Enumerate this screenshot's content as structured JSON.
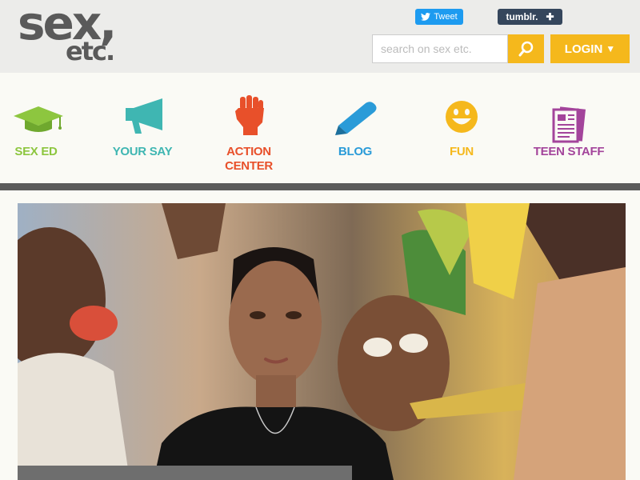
{
  "logo": {
    "line1": "sex,",
    "line2": "etc."
  },
  "social": {
    "tweet_label": "Tweet",
    "tumblr_label": "tumblr.",
    "tumblr_plus": "✚"
  },
  "search": {
    "placeholder": "search on sex etc.",
    "value": ""
  },
  "login": {
    "label": "LOGIN",
    "caret": "▼"
  },
  "nav": {
    "items": [
      {
        "label": "SEX ED",
        "color": "#8dc63f",
        "icon": "graduation-cap-icon"
      },
      {
        "label": "YOUR SAY",
        "color": "#3fb6b2",
        "icon": "megaphone-icon"
      },
      {
        "label": "ACTION\nCENTER",
        "color": "#e8502a",
        "icon": "raised-fist-icon"
      },
      {
        "label": "BLOG",
        "color": "#2a9bd8",
        "icon": "pencil-icon"
      },
      {
        "label": "FUN",
        "color": "#f5b81c",
        "icon": "smiley-face-icon"
      },
      {
        "label": "TEEN STAFF",
        "color": "#a3449b",
        "icon": "newspaper-icon"
      }
    ]
  },
  "hero": {
    "image": "mural-portrait-photo"
  }
}
